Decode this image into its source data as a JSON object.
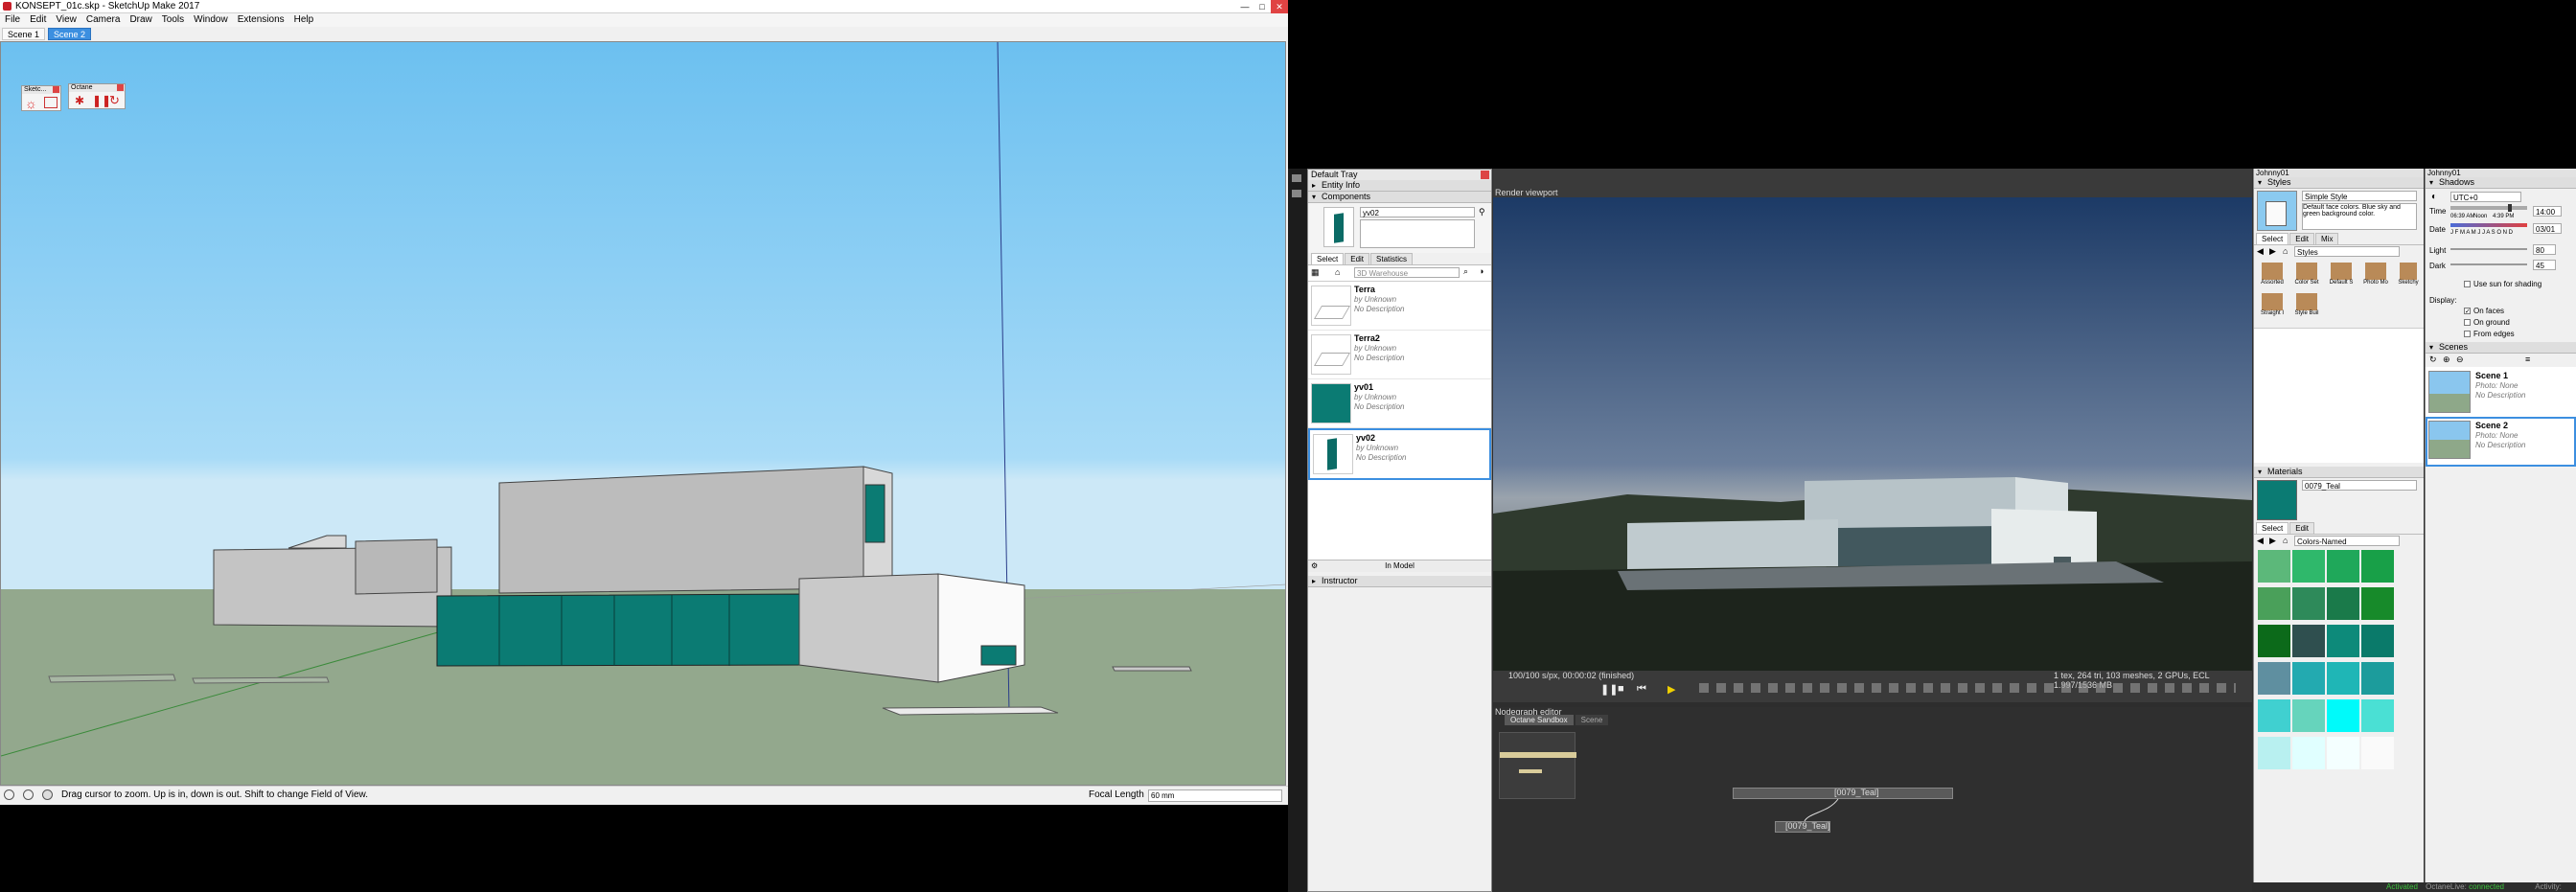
{
  "sketchup": {
    "title": "KONSEPT_01c.skp - SketchUp Make 2017",
    "menu": [
      "File",
      "Edit",
      "View",
      "Camera",
      "Draw",
      "Tools",
      "Window",
      "Extensions",
      "Help"
    ],
    "scene_tabs": [
      "Scene 1",
      "Scene 2"
    ],
    "active_scene_tab": "Scene 2",
    "toolbar_sketchup": "Sketc...",
    "toolbar_octane": "Octane",
    "status_text": "Drag cursor to zoom.  Up is in, down is out. Shift to change Field of View.",
    "measurement_label": "Focal Length",
    "measurement_value": "60 mm"
  },
  "tray": {
    "title": "Default Tray",
    "sections": {
      "entity_info": "Entity Info",
      "components": "Components",
      "instructor": "Instructor"
    },
    "component_name": "yv02",
    "tabs": [
      "Select",
      "Edit",
      "Statistics"
    ],
    "search_placeholder": "3D Warehouse",
    "items": [
      {
        "name": "Terra",
        "by": "by Unknown",
        "desc": "No Description"
      },
      {
        "name": "Terra2",
        "by": "by Unknown",
        "desc": "No Description"
      },
      {
        "name": "yv01",
        "by": "by Unknown",
        "desc": "No Description"
      },
      {
        "name": "yv02",
        "by": "by Unknown",
        "desc": "No Description"
      }
    ],
    "location": "In Model"
  },
  "octane": {
    "viewport_title": "Render viewport",
    "stats_left": "100/100 s/px, 00:00:02 (finished)",
    "stats_right": "1 tex, 264 tri, 103 meshes, 2 GPUs, ECL 1.997/1536 MB",
    "nodegraph_title": "Nodegraph editor",
    "nodegraph_tabs": [
      "Octane Sandbox",
      "Scene"
    ],
    "node_a": "[0079_Teal]",
    "node_b": "[0079_Teal]",
    "status": {
      "activated": "Activated",
      "live_label": "OctaneLive:",
      "live_value": "connected",
      "activity": "Activity:"
    }
  },
  "styles": {
    "header": "Johnny01",
    "section": "Styles",
    "style_name": "Simple Style",
    "style_desc": "Default face colors. Blue sky and green background color.",
    "tabs": [
      "Select",
      "Edit",
      "Mix"
    ],
    "dropdown": "Styles",
    "thumbs": [
      "Assorted",
      "Color Set",
      "Default S",
      "Photo Mo",
      "Sketchy",
      "Straight I",
      "Style Buil"
    ],
    "materials_section": "Materials",
    "material_name": "0079_Teal",
    "material_tabs": [
      "Select",
      "Edit"
    ],
    "material_dropdown": "Colors-Named",
    "material_colors": [
      "#5cb87a",
      "#2fb86b",
      "#1fa85a",
      "#18a048",
      "#4aa05a",
      "#2e8a5a",
      "#1a7a4a",
      "#178a2a",
      "#0c6a1a",
      "#2f4f4f",
      "#0d8a7a",
      "#0a7a6a",
      "#5f8fa0",
      "#23aab0",
      "#1fb6b6",
      "#1c9c9c",
      "#40d0d0",
      "#66d4bc",
      "#00fafa",
      "#4ae0d4",
      "#b8f0f0",
      "#e0ffff",
      "#f4ffff",
      "#fafafa"
    ]
  },
  "shadows": {
    "header": "Johnny01",
    "section": "Shadows",
    "utc": "UTC+0",
    "time_label": "Time",
    "time_left": "06:39 AM",
    "time_mid": "Noon",
    "time_right": "4:39 PM",
    "time_value": "14:00",
    "date_label": "Date",
    "months": "J F M A M J J A S O N D",
    "date_value": "03/01",
    "light_label": "Light",
    "light_value": "80",
    "dark_label": "Dark",
    "dark_value": "45",
    "use_sun": "Use sun for shading",
    "display_label": "Display:",
    "on_faces": "On faces",
    "on_ground": "On ground",
    "from_edges": "From edges",
    "scenes_section": "Scenes",
    "scenes": [
      {
        "name": "Scene 1",
        "photo": "Photo: None",
        "desc": "No Description"
      },
      {
        "name": "Scene 2",
        "photo": "Photo: None",
        "desc": "No Description"
      }
    ]
  },
  "colors": {
    "teal": "#0b7b73",
    "accent": "#3c8fe0",
    "sky": "#6cc0f0",
    "ground": "#93a88d"
  }
}
